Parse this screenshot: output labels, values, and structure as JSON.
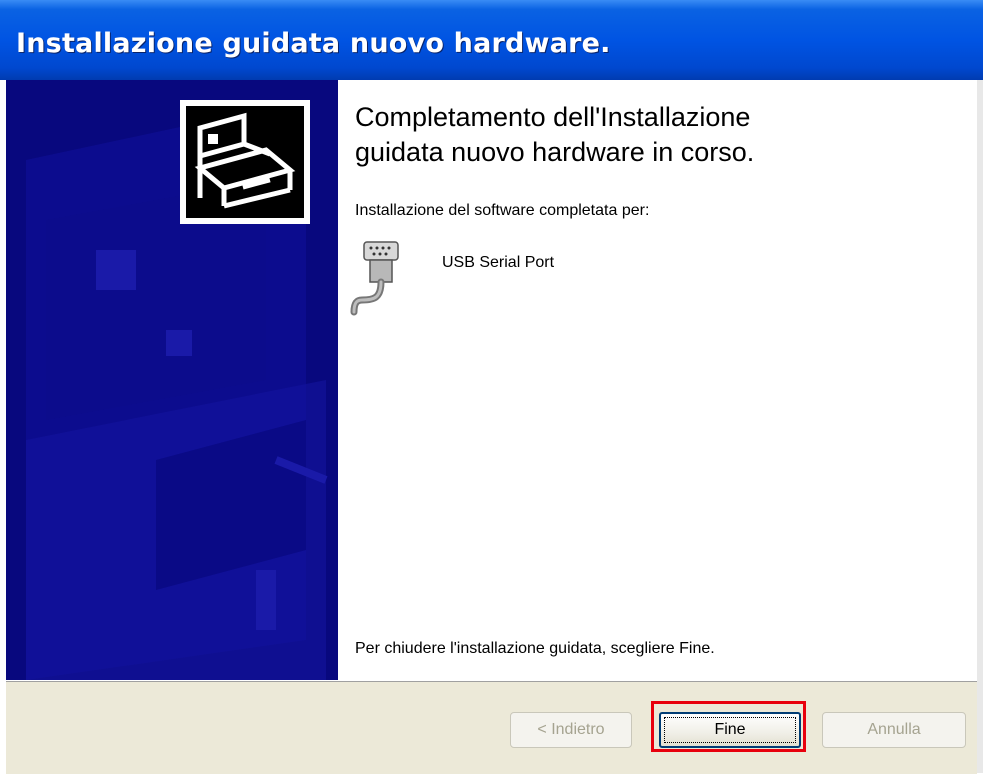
{
  "window": {
    "title": "Installazione guidata nuovo hardware."
  },
  "wizard": {
    "heading_line1": "Completamento dell'Installazione",
    "heading_line2": "guidata nuovo hardware in corso.",
    "subtext": "Installazione del software completata per:",
    "device": {
      "icon": "serial-port-icon",
      "name": "USB Serial Port"
    },
    "footer_text": "Per chiudere l'installazione guidata, scegliere Fine."
  },
  "buttons": {
    "back_label": "< Indietro",
    "finish_label": "Fine",
    "cancel_label": "Annulla"
  },
  "colors": {
    "titlebar": "#0054e3",
    "left_panel": "#08087e",
    "button_face": "#ece9d8",
    "highlight": "#e8000d"
  }
}
